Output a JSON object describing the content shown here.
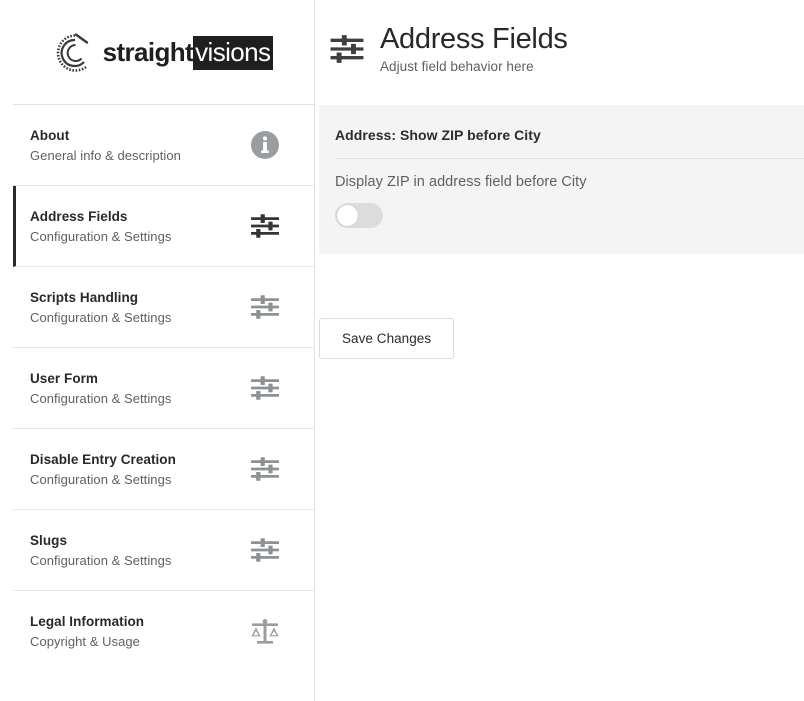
{
  "brand": {
    "logo_word_1": "straight",
    "logo_word_2": "visions",
    "logo_mark_icon": "circular-swirl-logo-mark"
  },
  "sidebar": {
    "items": [
      {
        "title": "About",
        "subtitle": "General info & description",
        "icon": "info-circle-icon",
        "active": false
      },
      {
        "title": "Address Fields",
        "subtitle": "Configuration & Settings",
        "icon": "sliders-icon",
        "active": true
      },
      {
        "title": "Scripts Handling",
        "subtitle": "Configuration & Settings",
        "icon": "sliders-icon",
        "active": false
      },
      {
        "title": "User Form",
        "subtitle": "Configuration & Settings",
        "icon": "sliders-icon",
        "active": false
      },
      {
        "title": "Disable Entry Creation",
        "subtitle": "Configuration & Settings",
        "icon": "sliders-icon",
        "active": false
      },
      {
        "title": "Slugs",
        "subtitle": "Configuration & Settings",
        "icon": "sliders-icon",
        "active": false
      },
      {
        "title": "Legal Information",
        "subtitle": "Copyright & Usage",
        "icon": "scales-of-justice-icon",
        "active": false
      }
    ]
  },
  "header": {
    "icon": "sliders-icon",
    "title": "Address Fields",
    "subtitle": "Adjust field behavior here"
  },
  "panel": {
    "title": "Address: Show ZIP before City",
    "field_label": "Display ZIP in address field before City",
    "toggle_state": "off"
  },
  "actions": {
    "save_label": "Save Changes"
  },
  "colors": {
    "accent_active": "#2b2b2b",
    "panel_bg": "#f4f4f4",
    "icon_inactive": "#8e9193",
    "icon_active": "#333536",
    "text_primary": "#27292b",
    "text_secondary": "#5e6163",
    "toggle_track_off": "#dcdcdc"
  }
}
